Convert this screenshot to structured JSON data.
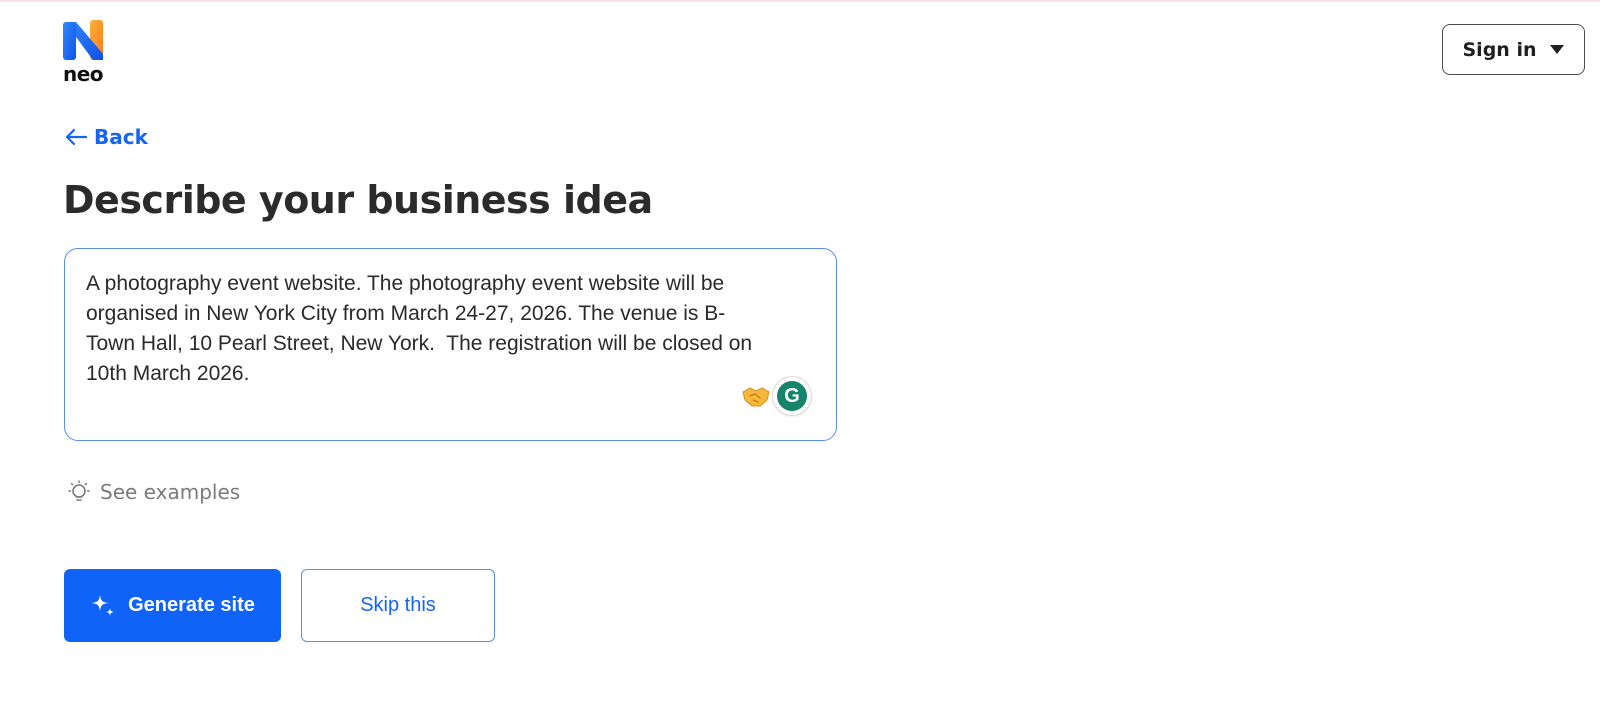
{
  "brand": {
    "name": "neo",
    "logo_icon": "neo-logo-icon"
  },
  "header": {
    "signin_label": "Sign in",
    "signin_icon": "caret-down-icon"
  },
  "nav": {
    "back_label": "Back",
    "back_icon": "arrow-left-icon"
  },
  "main": {
    "title": "Describe your business idea",
    "idea_value": "A photography event website. The photography event website will be\norganised in New York City from March 24-27, 2026. The venue is B-\nTown Hall, 10 Pearl Street, New York.  The registration will be closed on\n10th March 2026.",
    "textarea_icons": [
      "handshake-emoji-icon",
      "grammarly-icon"
    ],
    "examples_label": "See examples",
    "examples_icon": "lightbulb-icon",
    "generate_label": "Generate site",
    "generate_icon": "sparkles-icon",
    "skip_label": "Skip this"
  },
  "colors": {
    "accent": "#0f63f7",
    "text": "#2b2b2b",
    "muted": "#7a7a7a",
    "border": "#5b8def",
    "grammarly": "#15846b"
  }
}
